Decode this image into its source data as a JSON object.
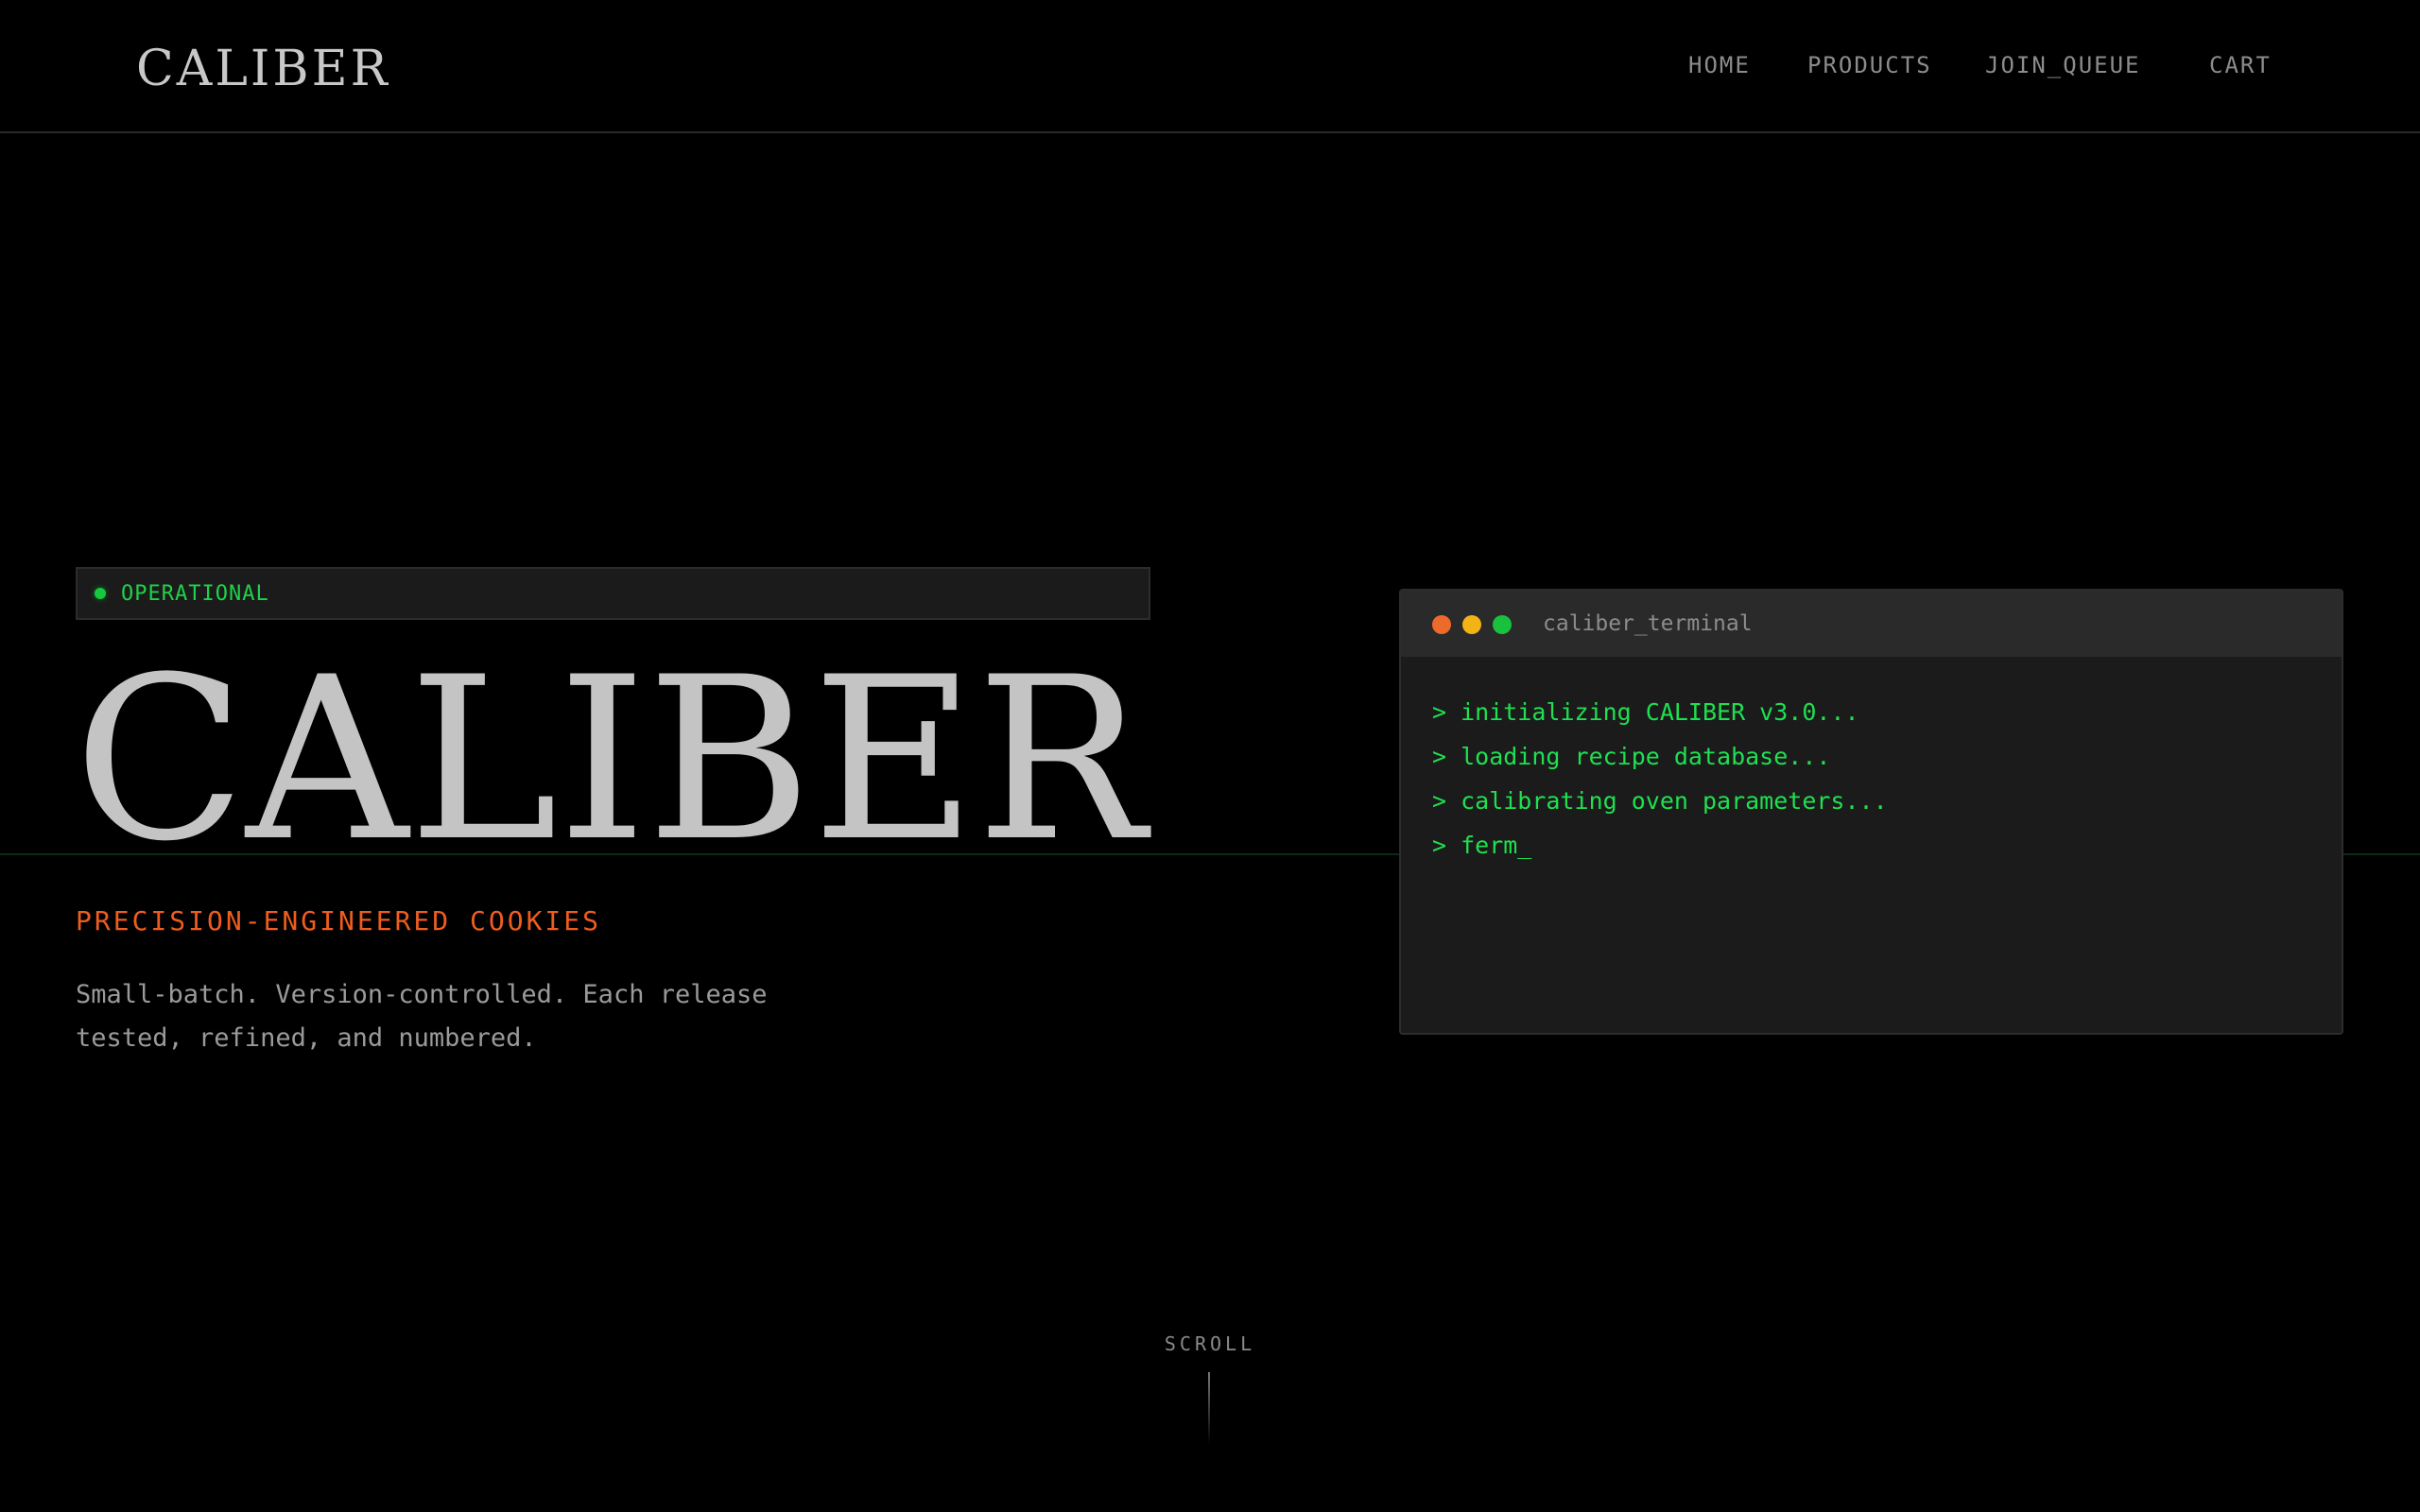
{
  "header": {
    "logo": "CALIBER",
    "nav": {
      "home": "HOME",
      "products": "PRODUCTS",
      "join_queue": "JOIN_QUEUE",
      "cart": "CART"
    }
  },
  "status": {
    "label": "OPERATIONAL",
    "color": "#16c93e"
  },
  "hero": {
    "title": "CALIBER",
    "tagline": "PRECISION-ENGINEERED COOKIES",
    "description": "Small-batch. Version-controlled. Each release tested, refined, and numbered."
  },
  "terminal": {
    "title": "caliber_terminal",
    "lines": [
      "> initializing CALIBER v3.0...",
      "> loading recipe database...",
      "> calibrating oven parameters...",
      "> ferm_"
    ]
  },
  "scroll": {
    "label": "SCROLL"
  },
  "colors": {
    "accent": "#ee5d1e",
    "terminal_text": "#1fe050",
    "background": "#000000"
  }
}
